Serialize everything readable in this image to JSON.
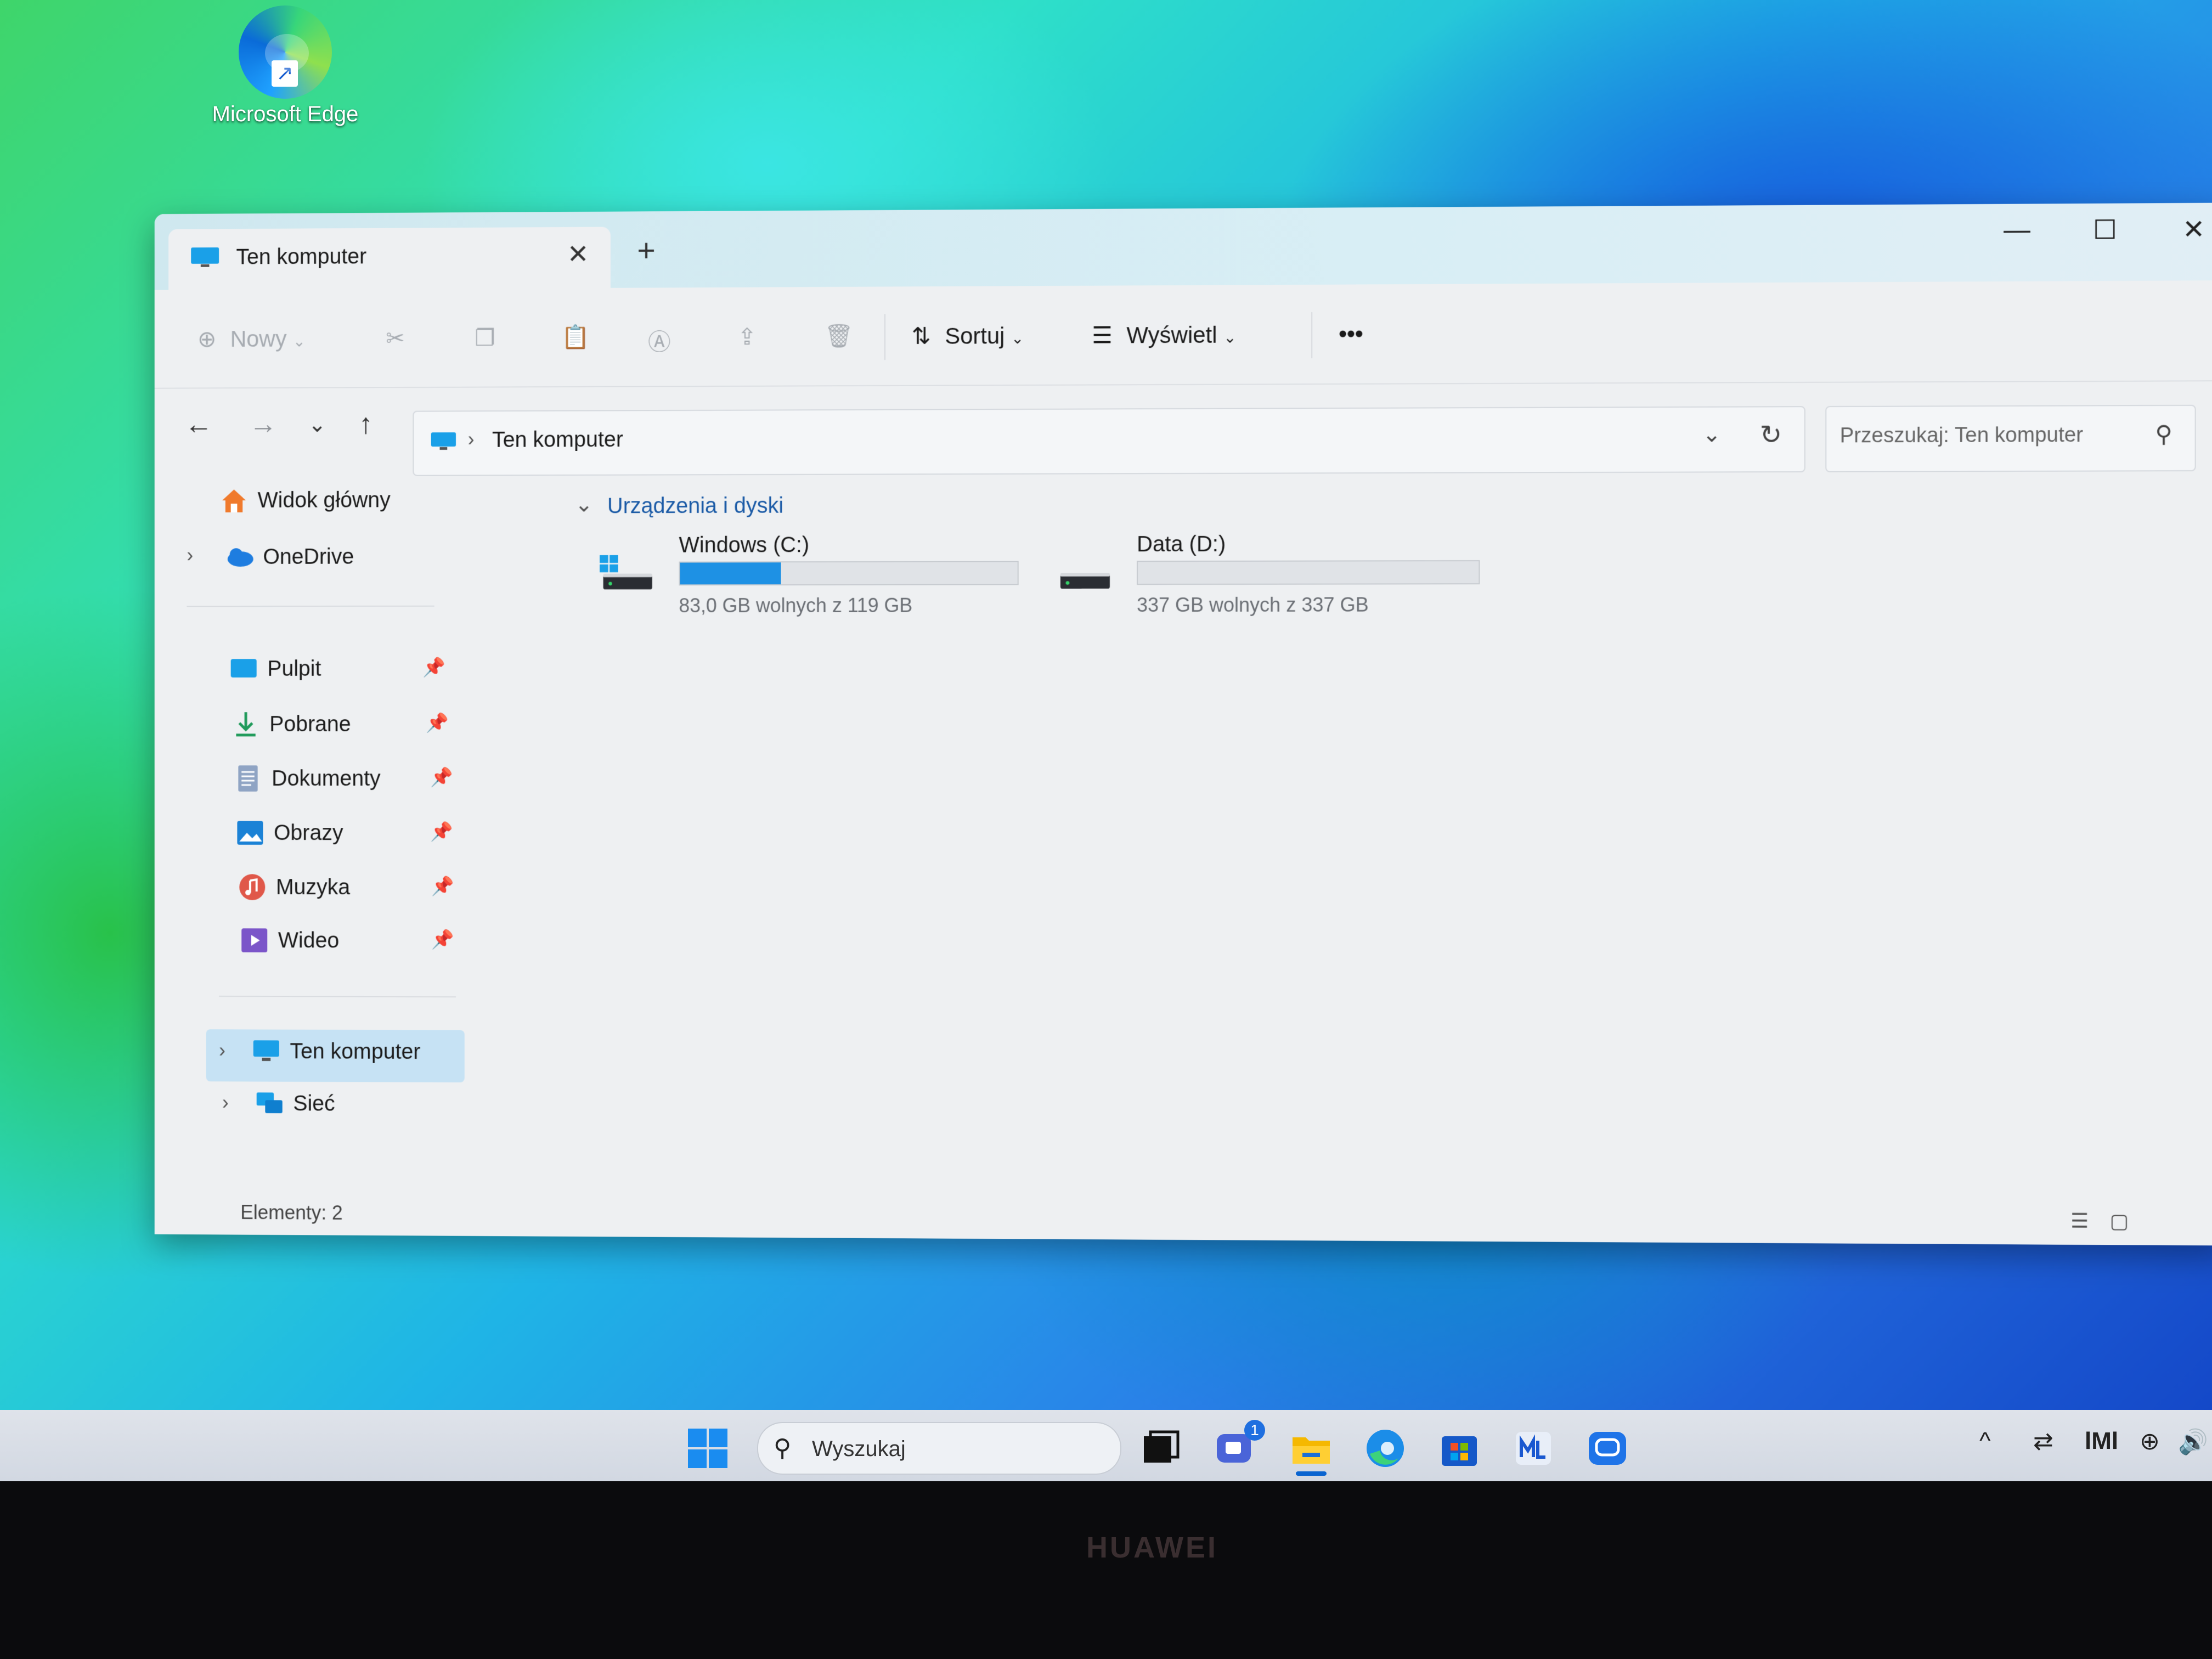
{
  "desktop": {
    "icons": [
      {
        "label": "Microsoft Edge",
        "icon": "edge-icon"
      }
    ]
  },
  "window": {
    "tab": {
      "title": "Ten komputer",
      "icon": "computer-icon"
    },
    "controls": {
      "new_tab": "+",
      "minimize": "—",
      "maximize": "☐",
      "close": "✕"
    },
    "toolbar": {
      "new_label": "Nowy",
      "sort_label": "Sortuj",
      "view_label": "Wyświetl",
      "more": "•••"
    },
    "navigation": {
      "address_path": "Ten komputer",
      "search_placeholder": "Przeszukaj: Ten komputer"
    },
    "sidebar": {
      "top_items": [
        {
          "label": "Widok główny",
          "icon": "home-icon"
        },
        {
          "label": "OneDrive",
          "icon": "cloud-icon",
          "expandable": true
        }
      ],
      "pinned_items": [
        {
          "label": "Pulpit",
          "icon": "desktop-folder-icon",
          "pinned": true
        },
        {
          "label": "Pobrane",
          "icon": "download-icon",
          "pinned": true
        },
        {
          "label": "Dokumenty",
          "icon": "document-icon",
          "pinned": true
        },
        {
          "label": "Obrazy",
          "icon": "pictures-icon",
          "pinned": true
        },
        {
          "label": "Muzyka",
          "icon": "music-icon",
          "pinned": true
        },
        {
          "label": "Wideo",
          "icon": "video-icon",
          "pinned": true
        }
      ],
      "bottom_items": [
        {
          "label": "Ten komputer",
          "icon": "computer-icon",
          "selected": true
        },
        {
          "label": "Sieć",
          "icon": "network-icon"
        }
      ]
    },
    "content": {
      "section_title": "Urządzenia i dyski",
      "drives": [
        {
          "name": "Windows (C:)",
          "free_text": "83,0 GB wolnych z 119 GB",
          "used_fraction": 0.3
        },
        {
          "name": "Data (D:)",
          "free_text": "337 GB wolnych z 337 GB",
          "used_fraction": 0.0
        }
      ]
    },
    "status": {
      "items_text": "Elementy: 2"
    }
  },
  "taskbar": {
    "search_placeholder": "Wyszukaj",
    "apps": [
      "start-icon",
      "task-view-icon",
      "teams-chat-icon",
      "file-explorer-icon",
      "edge-icon",
      "store-icon",
      "huawei-pc-manager-icon",
      "huawei-share-icon"
    ],
    "chat_badge": "1"
  },
  "device": {
    "brand": "HUAWEI"
  },
  "colors": {
    "accent": "#1e91e4",
    "selection": "#c6e2f4",
    "section_title": "#1a5aa6"
  }
}
